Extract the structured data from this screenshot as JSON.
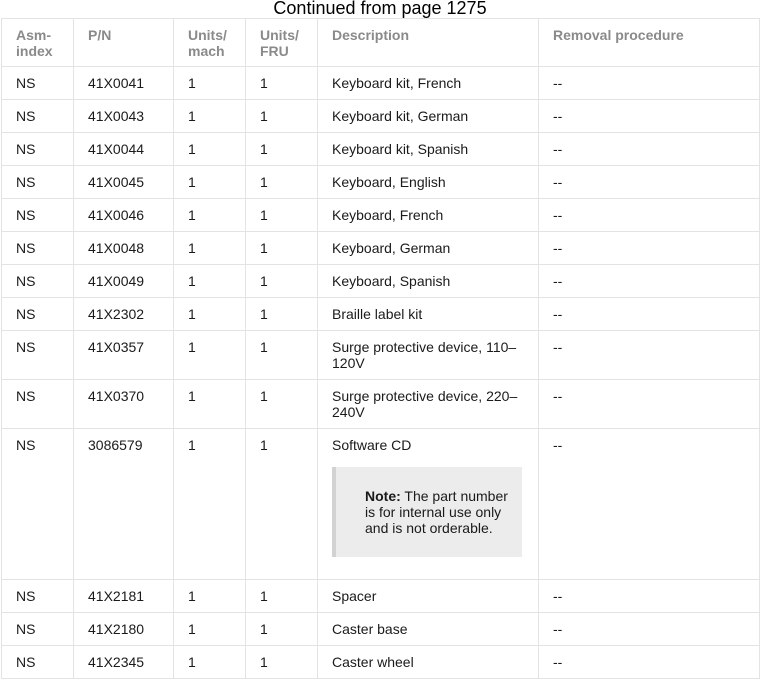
{
  "caption": "Continued from page 1275",
  "columns": [
    "Asm-\nindex",
    "P/N",
    "Units/\nmach",
    "Units/\nFRU",
    "Description",
    "Removal procedure"
  ],
  "rows": [
    {
      "asm": "NS",
      "pn": "41X0041",
      "units_mach": "1",
      "units_fru": "1",
      "description": "Keyboard kit, French",
      "removal": "--"
    },
    {
      "asm": "NS",
      "pn": "41X0043",
      "units_mach": "1",
      "units_fru": "1",
      "description": "Keyboard kit, German",
      "removal": "--"
    },
    {
      "asm": "NS",
      "pn": "41X0044",
      "units_mach": "1",
      "units_fru": "1",
      "description": "Keyboard kit, Spanish",
      "removal": "--"
    },
    {
      "asm": "NS",
      "pn": "41X0045",
      "units_mach": "1",
      "units_fru": "1",
      "description": "Keyboard, English",
      "removal": "--"
    },
    {
      "asm": "NS",
      "pn": "41X0046",
      "units_mach": "1",
      "units_fru": "1",
      "description": "Keyboard, French",
      "removal": "--"
    },
    {
      "asm": "NS",
      "pn": "41X0048",
      "units_mach": "1",
      "units_fru": "1",
      "description": "Keyboard, German",
      "removal": "--"
    },
    {
      "asm": "NS",
      "pn": "41X0049",
      "units_mach": "1",
      "units_fru": "1",
      "description": "Keyboard, Spanish",
      "removal": "--"
    },
    {
      "asm": "NS",
      "pn": "41X2302",
      "units_mach": "1",
      "units_fru": "1",
      "description": "Braille label kit",
      "removal": "--"
    },
    {
      "asm": "NS",
      "pn": "41X0357",
      "units_mach": "1",
      "units_fru": "1",
      "description": "Surge protective device, 110–120V",
      "removal": "--"
    },
    {
      "asm": "NS",
      "pn": "41X0370",
      "units_mach": "1",
      "units_fru": "1",
      "description": "Surge protective device, 220–240V",
      "removal": "--"
    },
    {
      "asm": "NS",
      "pn": "3086579",
      "units_mach": "1",
      "units_fru": "1",
      "description": "Software CD",
      "note_label": "Note:",
      "note_text": " The part number is for internal use only and is not orderable.",
      "removal": "--"
    },
    {
      "asm": "NS",
      "pn": "41X2181",
      "units_mach": "1",
      "units_fru": "1",
      "description": "Spacer",
      "removal": "--"
    },
    {
      "asm": "NS",
      "pn": "41X2180",
      "units_mach": "1",
      "units_fru": "1",
      "description": "Caster base",
      "removal": "--"
    },
    {
      "asm": "NS",
      "pn": "41X2345",
      "units_mach": "1",
      "units_fru": "1",
      "description": "Caster wheel",
      "removal": "--"
    }
  ]
}
